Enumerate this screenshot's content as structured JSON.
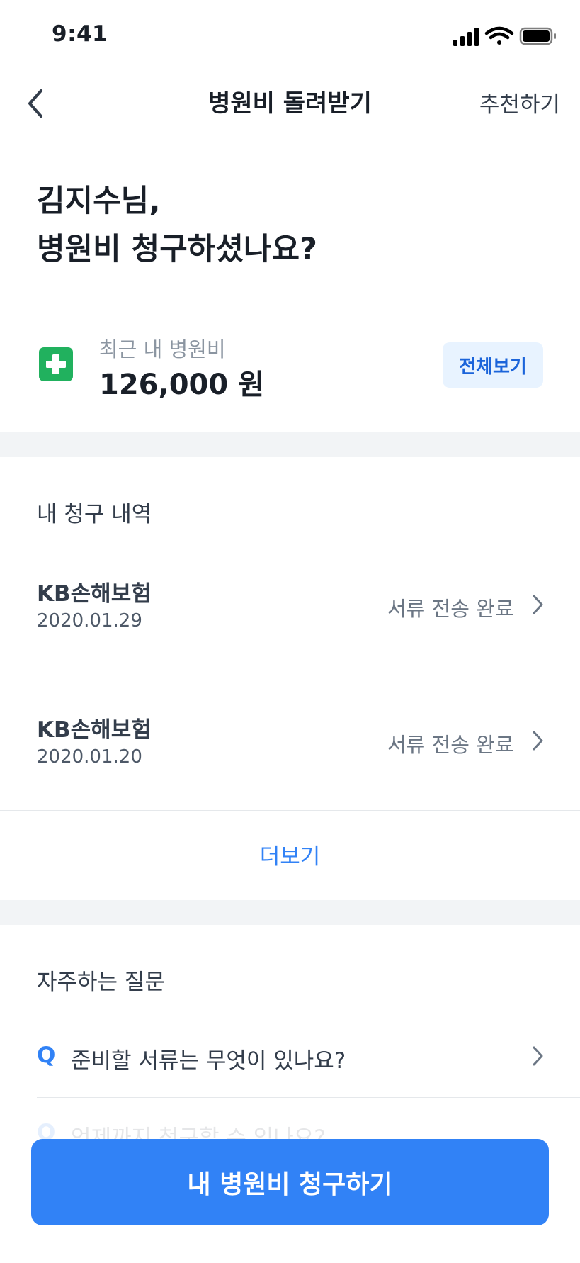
{
  "status_bar": {
    "time": "9:41"
  },
  "nav": {
    "title": "병원비 돌려받기",
    "right_label": "추천하기"
  },
  "headline": {
    "line1": "김지수님,",
    "line2": "병원비 청구하셨나요?"
  },
  "recent": {
    "label": "최근 내 병원비",
    "amount": "126,000 원",
    "view_all": "전체보기"
  },
  "claims": {
    "title": "내 청구 내역",
    "items": [
      {
        "company": "KB손해보험",
        "date": "2020.01.29",
        "status": "서류 전송 완료"
      },
      {
        "company": "KB손해보험",
        "date": "2020.01.20",
        "status": "서류 전송 완료"
      }
    ],
    "more": "더보기"
  },
  "faq": {
    "title": "자주하는 질문",
    "items": [
      {
        "q": "Q",
        "text": "준비할 서류는 무엇이 있나요?"
      },
      {
        "q": "Q",
        "text": "언제까지 청구할 수 있나요?"
      }
    ]
  },
  "cta": {
    "label": "내 병원비 청구하기"
  },
  "colors": {
    "accent": "#3182f6",
    "cross": "#21b15e",
    "band": "#f2f4f6"
  }
}
